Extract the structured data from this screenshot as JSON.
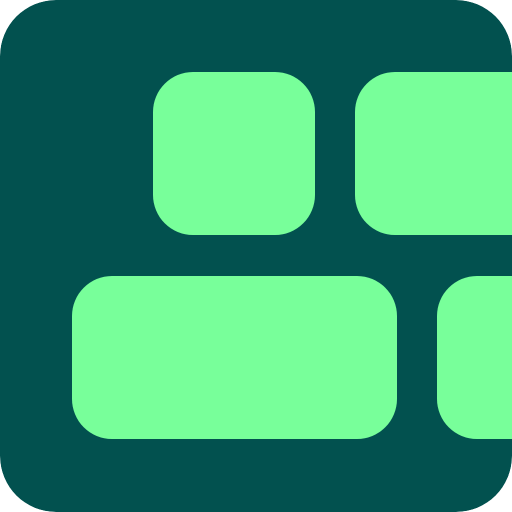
{
  "icon": {
    "name": "app-icon-blocks",
    "colors": {
      "background": "#02514f",
      "tile": "#78ff9a"
    },
    "tiles": [
      "tile-top-left",
      "tile-top-right",
      "tile-bottom-wide",
      "tile-bottom-right"
    ]
  }
}
